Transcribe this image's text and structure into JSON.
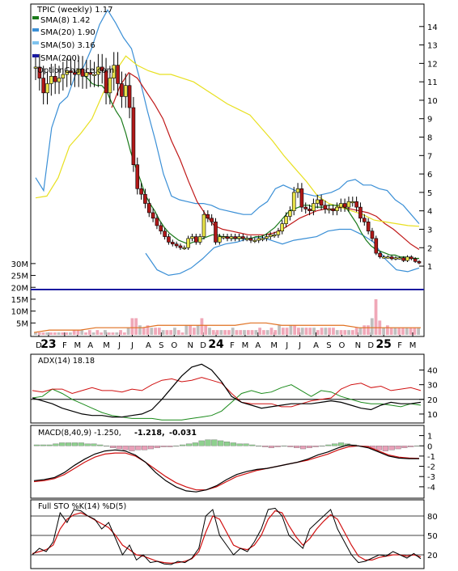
{
  "title": "TPIC (weekly) 1.17",
  "watermark": "OptionChance.com",
  "legend": [
    {
      "label": "TPIC (weekly) 1.17",
      "color": "#000000",
      "swatch": false
    },
    {
      "label": "SMA(8) 1.42",
      "color": "#1a7a1a",
      "swatch": true
    },
    {
      "label": "SMA(20) 1.90",
      "color": "#3a8fd6",
      "swatch": true
    },
    {
      "label": "SMA(50) 3.16",
      "color": "#7ec3ee",
      "swatch": true
    },
    {
      "label": "SMA(200)",
      "color": "#1a1aa0",
      "swatch": true
    }
  ],
  "x_labels": [
    {
      "w": 1,
      "text": "D"
    },
    {
      "w": 4,
      "text": "23",
      "bold": true
    },
    {
      "w": 9,
      "text": "F"
    },
    {
      "w": 13,
      "text": "M"
    },
    {
      "w": 17,
      "text": "A"
    },
    {
      "w": 22,
      "text": "M"
    },
    {
      "w": 26,
      "text": "J"
    },
    {
      "w": 30,
      "text": "J"
    },
    {
      "w": 35,
      "text": "A"
    },
    {
      "w": 39,
      "text": "S"
    },
    {
      "w": 43,
      "text": "O"
    },
    {
      "w": 48,
      "text": "N"
    },
    {
      "w": 52,
      "text": "D"
    },
    {
      "w": 56,
      "text": "24",
      "bold": true
    },
    {
      "w": 61,
      "text": "F"
    },
    {
      "w": 65,
      "text": "M"
    },
    {
      "w": 69,
      "text": "A"
    },
    {
      "w": 74,
      "text": "M"
    },
    {
      "w": 78,
      "text": "J"
    },
    {
      "w": 82,
      "text": "J"
    },
    {
      "w": 87,
      "text": "A"
    },
    {
      "w": 91,
      "text": "S"
    },
    {
      "w": 95,
      "text": "O"
    },
    {
      "w": 100,
      "text": "N"
    },
    {
      "w": 104,
      "text": "D"
    },
    {
      "w": 108,
      "text": "25",
      "bold": true
    },
    {
      "w": 113,
      "text": "F"
    },
    {
      "w": 117,
      "text": "M"
    }
  ],
  "price_ticks": [
    1,
    2,
    3,
    4,
    5,
    6,
    7,
    8,
    9,
    10,
    11,
    12,
    13,
    14
  ],
  "volume_ticks": [
    "5M",
    "10M",
    "15M",
    "20M",
    "25M",
    "30M"
  ],
  "panels": {
    "adx": {
      "label": "ADX(14) 18.18",
      "ticks": [
        10,
        20,
        30,
        40
      ]
    },
    "macd": {
      "label": "MACD(8,40,9) -1.250,",
      "val1": "-1.218,",
      "val1_color": "#d01010",
      "val2": "-0.031",
      "val2_color": "#1a3fd0",
      "ticks": [
        -4,
        -3,
        -2,
        -1,
        0,
        1
      ]
    },
    "sto": {
      "label": "Full STO %K(14) %D(5)",
      "ticks": [
        20,
        50,
        80
      ]
    }
  },
  "chart_data": {
    "type": "line",
    "title": "TPIC (weekly) 1.17",
    "x_unit": "week index (Dec 2022 – Mar 2025)",
    "price": {
      "ylim": [
        0.3,
        15
      ],
      "close": [
        11.8,
        11.2,
        10.4,
        10.9,
        11.3,
        11.0,
        11.2,
        11.4,
        11.6,
        11.5,
        11.4,
        11.7,
        11.3,
        11.5,
        11.4,
        11.4,
        11.8,
        11.6,
        10.4,
        11.2,
        11.9,
        10.9,
        10.2,
        10.8,
        9.6,
        6.5,
        5.2,
        4.9,
        4.4,
        3.9,
        3.6,
        3.2,
        2.9,
        2.6,
        2.3,
        2.2,
        2.1,
        2.0,
        2.0,
        2.5,
        2.6,
        2.3,
        2.6,
        3.8,
        3.6,
        3.4,
        2.3,
        2.6,
        2.6,
        2.5,
        2.6,
        2.5,
        2.6,
        2.5,
        2.5,
        2.4,
        2.4,
        2.5,
        2.5,
        2.6,
        2.7,
        2.7,
        2.9,
        3.3,
        3.7,
        4.0,
        5.0,
        5.2,
        4.2,
        4.1,
        4.0,
        4.4,
        4.6,
        4.3,
        4.1,
        4.1,
        4.0,
        4.2,
        4.4,
        4.2,
        4.5,
        4.5,
        4.2,
        3.6,
        3.4,
        2.9,
        2.5,
        1.7,
        1.5,
        1.5,
        1.5,
        1.4,
        1.45,
        1.45,
        1.3,
        1.5,
        1.4,
        1.25,
        1.17
      ],
      "sma8_start": 12,
      "sma8": [
        11.4,
        11.2,
        10.9,
        10.8,
        10.8,
        10.5,
        9.9,
        9.4,
        9.0,
        8.2,
        7.2,
        6.4,
        5.7,
        4.9,
        4.4,
        4.0,
        3.5,
        3.1,
        2.8,
        2.6,
        2.4,
        2.3,
        2.2,
        2.3,
        2.4,
        2.5,
        2.6,
        2.7,
        2.7,
        2.6,
        2.6,
        2.5,
        2.5,
        2.5,
        2.5,
        2.5,
        2.6,
        2.6,
        2.7,
        2.9,
        3.1,
        3.4,
        3.7,
        4.0,
        4.1,
        4.2,
        4.3,
        4.3,
        4.2,
        4.2,
        4.2,
        4.3,
        4.3,
        4.3,
        4.3,
        4.1,
        3.7,
        3.3,
        2.8,
        2.4,
        2.1,
        1.9,
        1.8,
        1.7,
        1.6,
        1.6,
        1.5,
        1.5,
        1.45,
        1.42,
        1.42
      ],
      "sma20_upper": [
        5.8,
        5.1,
        8.5,
        9.8,
        10.2,
        11.4,
        11.8,
        12.8,
        14.1,
        14.9,
        14.2,
        13.4,
        12.8,
        11.2,
        9.4,
        7.8,
        6.0,
        4.8,
        4.6,
        4.5,
        4.4,
        4.4,
        4.3,
        4.1,
        4.0,
        3.9,
        3.8,
        3.8,
        4.2,
        4.5,
        5.2,
        5.4,
        5.2,
        5.0,
        4.9,
        4.8,
        4.9,
        5.0,
        5.2,
        5.6,
        5.7,
        5.4,
        5.4,
        5.2,
        5.1,
        4.6,
        4.3,
        3.8,
        3.3
      ],
      "sma20_mid": [
        9.6,
        10.8,
        11.5,
        11.2,
        10.5,
        9.8,
        9.0,
        7.8,
        6.8,
        5.6,
        4.5,
        3.8,
        3.2,
        3.0,
        2.9,
        2.8,
        2.7,
        2.7,
        2.7,
        2.8,
        3.0,
        3.3,
        3.6,
        3.8,
        4.0,
        4.1,
        4.1,
        4.2,
        4.1,
        4.0,
        3.9,
        3.7,
        3.3,
        3.0,
        2.6,
        2.2,
        1.9
      ],
      "sma20_lower": [
        1.7,
        0.8,
        0.5,
        0.6,
        0.9,
        1.4,
        2.0,
        2.2,
        2.3,
        2.5,
        2.6,
        2.4,
        2.2,
        2.4,
        2.5,
        2.6,
        2.9,
        3.0,
        3.0,
        2.7,
        2.3,
        1.4,
        0.8,
        0.7,
        0.9
      ],
      "sma50": [
        4.7,
        4.8,
        5.8,
        7.5,
        8.2,
        9.0,
        10.4,
        11.5,
        12.4,
        11.9,
        11.6,
        11.4,
        11.4,
        11.2,
        11.0,
        10.6,
        10.2,
        9.8,
        9.5,
        9.2,
        8.5,
        7.8,
        7.0,
        6.3,
        5.6,
        4.8,
        4.4,
        4.2,
        4.0,
        3.8,
        3.5,
        3.4,
        3.3,
        3.2,
        3.16
      ],
      "sma200_level": 2
    },
    "volume": {
      "ylim": [
        0,
        32
      ],
      "values": [
        1,
        1,
        1,
        1,
        1,
        1,
        1,
        1,
        1,
        1,
        2,
        2,
        2,
        1,
        2,
        1,
        2,
        1,
        2,
        1,
        1,
        1,
        2,
        1,
        3,
        7,
        7,
        4,
        3,
        4,
        3,
        3,
        3,
        2,
        2,
        2,
        3,
        2,
        1,
        4,
        4,
        3,
        4,
        7,
        4,
        3,
        2,
        2,
        2,
        2,
        2,
        3,
        2,
        2,
        2,
        2,
        2,
        2,
        3,
        2,
        2,
        3,
        2,
        4,
        3,
        3,
        4,
        4,
        3,
        3,
        3,
        3,
        3,
        2,
        3,
        3,
        3,
        3,
        2,
        2,
        2,
        2,
        2,
        3,
        3,
        4,
        4,
        7,
        15,
        6,
        3,
        4,
        3,
        3,
        3,
        3,
        3,
        3,
        3,
        3
      ],
      "avg_line": [
        1,
        2,
        2,
        2,
        3,
        3,
        3,
        3,
        4,
        4,
        4,
        4,
        4,
        4,
        5,
        5,
        4,
        4,
        4,
        4,
        4,
        3,
        3,
        3,
        3,
        3
      ]
    },
    "adx": {
      "ylim": [
        5,
        48
      ],
      "adx": [
        21,
        19,
        17,
        14,
        12,
        10,
        9,
        9,
        8,
        8,
        9,
        10,
        13,
        20,
        28,
        36,
        42,
        44,
        40,
        32,
        22,
        18,
        16,
        14,
        15,
        16,
        17,
        17,
        17,
        18,
        19,
        18,
        16,
        14,
        13,
        16,
        18,
        17,
        17,
        18
      ],
      "plus_di": [
        21,
        22,
        27,
        24,
        20,
        17,
        14,
        11,
        9,
        8,
        7,
        7,
        7,
        6,
        6,
        6,
        7,
        8,
        9,
        12,
        18,
        24,
        26,
        24,
        25,
        28,
        30,
        26,
        22,
        26,
        25,
        22,
        20,
        18,
        17,
        17,
        16,
        15,
        17,
        16
      ],
      "minus_di": [
        26,
        25,
        27,
        27,
        24,
        26,
        28,
        26,
        26,
        25,
        27,
        26,
        30,
        33,
        34,
        32,
        33,
        35,
        33,
        31,
        24,
        18,
        17,
        17,
        17,
        15,
        15,
        17,
        19,
        20,
        21,
        27,
        30,
        31,
        28,
        29,
        26,
        27,
        28,
        26
      ]
    },
    "macd": {
      "ylim": [
        -4.8,
        1.6
      ],
      "macd": [
        -3.4,
        -3.3,
        -3.1,
        -2.6,
        -1.9,
        -1.3,
        -0.8,
        -0.5,
        -0.4,
        -0.5,
        -0.9,
        -1.6,
        -2.6,
        -3.4,
        -4.0,
        -4.4,
        -4.5,
        -4.3,
        -3.9,
        -3.3,
        -2.8,
        -2.5,
        -2.3,
        -2.2,
        -2.0,
        -1.8,
        -1.6,
        -1.3,
        -0.9,
        -0.6,
        -0.2,
        0.1,
        0.0,
        -0.2,
        -0.6,
        -1.0,
        -1.2,
        -1.25,
        -1.25
      ],
      "signal": [
        -3.5,
        -3.4,
        -3.2,
        -2.8,
        -2.2,
        -1.6,
        -1.1,
        -0.8,
        -0.7,
        -0.7,
        -1.0,
        -1.6,
        -2.3,
        -3.0,
        -3.6,
        -4.0,
        -4.3,
        -4.3,
        -4.0,
        -3.5,
        -3.0,
        -2.7,
        -2.4,
        -2.2,
        -2.0,
        -1.8,
        -1.6,
        -1.4,
        -1.1,
        -0.8,
        -0.4,
        -0.1,
        0.0,
        -0.1,
        -0.5,
        -0.9,
        -1.1,
        -1.2,
        -1.22
      ],
      "hist": [
        0.1,
        0.1,
        0.1,
        0.2,
        0.3,
        0.3,
        0.3,
        0.3,
        0.2,
        0.2,
        0.1,
        0.0,
        -0.2,
        -0.3,
        -0.4,
        -0.5,
        -0.4,
        -0.4,
        -0.3,
        -0.2,
        -0.1,
        -0.1,
        0.0,
        0.1,
        0.2,
        0.3,
        0.5,
        0.6,
        0.6,
        0.5,
        0.4,
        0.3,
        0.2,
        0.2,
        0.1,
        0.0,
        -0.1,
        -0.2,
        -0.1,
        0.0,
        -0.1,
        -0.2,
        -0.3,
        -0.2,
        -0.1,
        0.0,
        0.1,
        0.2,
        0.3,
        0.2,
        0.1,
        0.0,
        -0.1,
        -0.3,
        -0.4,
        -0.5,
        -0.4,
        -0.3,
        -0.2,
        -0.1,
        0.0
      ]
    },
    "sto": {
      "ylim": [
        0,
        100
      ],
      "k": [
        20,
        30,
        25,
        40,
        85,
        70,
        90,
        88,
        80,
        75,
        60,
        70,
        45,
        20,
        35,
        12,
        20,
        8,
        10,
        6,
        5,
        10,
        8,
        15,
        30,
        80,
        90,
        50,
        35,
        20,
        30,
        25,
        40,
        60,
        90,
        92,
        80,
        50,
        40,
        30,
        60,
        70,
        80,
        90,
        60,
        40,
        20,
        8,
        10,
        15,
        20,
        18,
        25,
        20,
        15,
        22,
        14
      ],
      "d": [
        22,
        25,
        28,
        35,
        60,
        75,
        82,
        85,
        80,
        74,
        68,
        62,
        50,
        35,
        28,
        20,
        18,
        14,
        10,
        8,
        7,
        8,
        10,
        14,
        25,
        55,
        80,
        75,
        55,
        35,
        30,
        28,
        35,
        50,
        75,
        88,
        85,
        65,
        48,
        35,
        45,
        60,
        72,
        82,
        75,
        55,
        35,
        18,
        12,
        12,
        16,
        18,
        20,
        20,
        18,
        20,
        17
      ]
    }
  }
}
